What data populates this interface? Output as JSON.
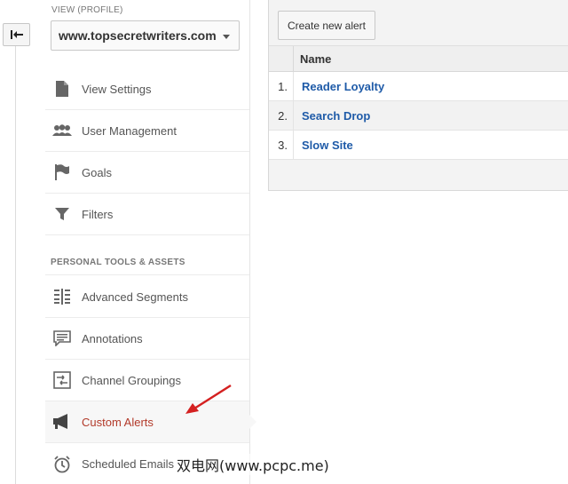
{
  "sidebar": {
    "view_label": "VIEW (PROFILE)",
    "view_value": "www.topsecretwriters.com",
    "items": [
      {
        "label": "View Settings",
        "icon": "document-icon"
      },
      {
        "label": "User Management",
        "icon": "users-icon"
      },
      {
        "label": "Goals",
        "icon": "flag-icon"
      },
      {
        "label": "Filters",
        "icon": "filter-icon"
      }
    ],
    "section_header": "PERSONAL TOOLS & ASSETS",
    "tools": [
      {
        "label": "Advanced Segments",
        "icon": "segments-icon"
      },
      {
        "label": "Annotations",
        "icon": "annotation-icon"
      },
      {
        "label": "Channel Groupings",
        "icon": "channel-icon"
      },
      {
        "label": "Custom Alerts",
        "icon": "megaphone-icon",
        "active": true
      },
      {
        "label": "Scheduled Emails",
        "icon": "clock-icon"
      }
    ]
  },
  "main": {
    "create_button": "Create new alert",
    "column_name": "Name",
    "rows": [
      {
        "num": "1.",
        "name": "Reader Loyalty"
      },
      {
        "num": "2.",
        "name": "Search Drop"
      },
      {
        "num": "3.",
        "name": "Slow Site"
      }
    ]
  },
  "watermark": "双电网(www.pcpc.me)",
  "colors": {
    "link": "#1f5ba8",
    "active": "#b23a2a",
    "annotation_arrow": "#d42020"
  }
}
